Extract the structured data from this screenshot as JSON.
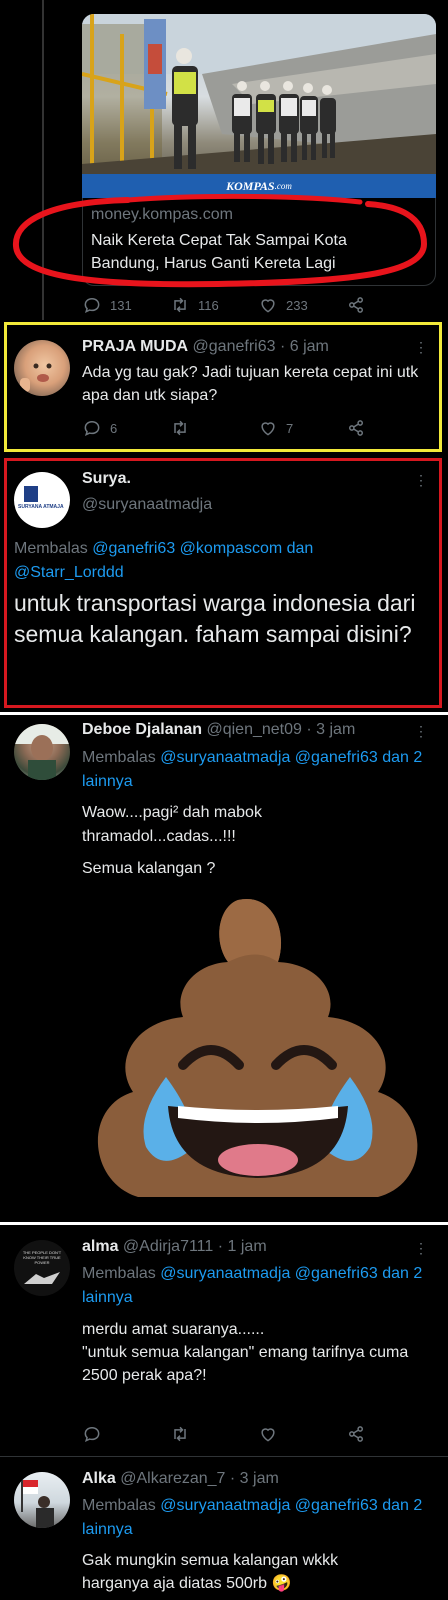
{
  "tweet1": {
    "image_watermark": "KOMPAS",
    "image_watermark_suffix": ".com",
    "link_domain": "money.kompas.com",
    "link_title": "Naik Kereta Cepat Tak Sampai Kota Bandung, Harus Ganti Kereta Lagi",
    "replies": "131",
    "retweets": "116",
    "likes": "233"
  },
  "tweet2": {
    "name": "PRAJA MUDA",
    "handle": "@ganefri63",
    "time": "· 6 jam",
    "text": "Ada yg tau gak? Jadi tujuan kereta cepat ini utk apa dan utk siapa?",
    "replies": "6",
    "likes": "7"
  },
  "tweet3": {
    "name": "Surya.",
    "handle": "@suryanaatmadja",
    "avatar_text": "SURYANA ATMAJA",
    "reply_prefix": "Membalas",
    "reply_to": "@ganefri63 @kompascom dan @Starr_Lorddd",
    "text": "untuk transportasi warga indonesia dari semua kalangan. faham sampai disini?"
  },
  "tweet4": {
    "name": "Deboe Djalanan",
    "handle": "@qien_net09",
    "time": "· 3 jam",
    "reply_prefix": "Membalas",
    "reply_to": "@suryanaatmadja @ganefri63 dan 2 lainnya",
    "text1": "Waow....pagi² dah mabok thramadol...cadas...!!!",
    "text2": "Semua kalangan ?"
  },
  "tweet5": {
    "name": "alma",
    "handle": "@Adirja7111",
    "time": "· 1 jam",
    "avatar_text": "THE PEOPLE DON'T KNOW THEIR TRUE POWER",
    "reply_prefix": "Membalas",
    "reply_to": "@suryanaatmadja @ganefri63 dan 2 lainnya",
    "text1": "merdu amat suaranya......",
    "text2": "\"untuk semua kalangan\" emang tarifnya cuma 2500 perak apa?!"
  },
  "tweet6": {
    "name": "Alka",
    "handle": "@Alkarezan_7",
    "time": "· 3 jam",
    "reply_prefix": "Membalas",
    "reply_to": "@suryanaatmadja @ganefri63 dan 2 lainnya",
    "text": "Gak mungkin semua kalangan wkkk harganya aja diatas 500rb 🤪"
  },
  "colors": {
    "background": "#000000",
    "link_blue": "#1d9bf0",
    "muted": "#6e767d",
    "highlight_red": "#e8141c",
    "highlight_yellow": "#f2e93a",
    "frame_red": "#d6181f"
  }
}
